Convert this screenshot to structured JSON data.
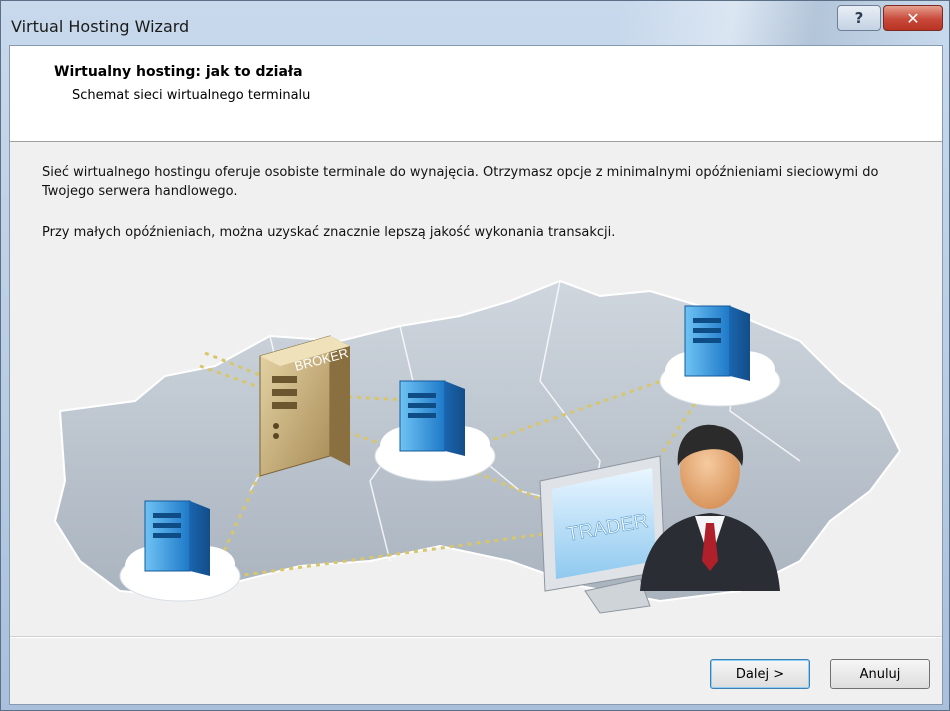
{
  "window": {
    "title": "Virtual Hosting Wizard",
    "help_glyph": "?",
    "close_glyph": "✕"
  },
  "header": {
    "title": "Wirtualny hosting: jak to działa",
    "subtitle": "Schemat sieci wirtualnego terminalu"
  },
  "body": {
    "paragraph1": "Sieć wirtualnego hostingu oferuje osobiste terminale do wynajęcia. Otrzymasz opcje z minimalnymi opóźnieniami sieciowymi do Twojego serwera handlowego.",
    "paragraph2": "Przy małych opóźnieniach, można uzyskać znacznie lepszą  jakość wykonania transakcji."
  },
  "illustration": {
    "broker_label": "BROKER",
    "trader_label": "TRADER"
  },
  "buttons": {
    "next": "Dalej >",
    "cancel": "Anuluj"
  },
  "colors": {
    "accent": "#3c7fb1",
    "close": "#c8483a",
    "map": "#b8c1cb"
  }
}
